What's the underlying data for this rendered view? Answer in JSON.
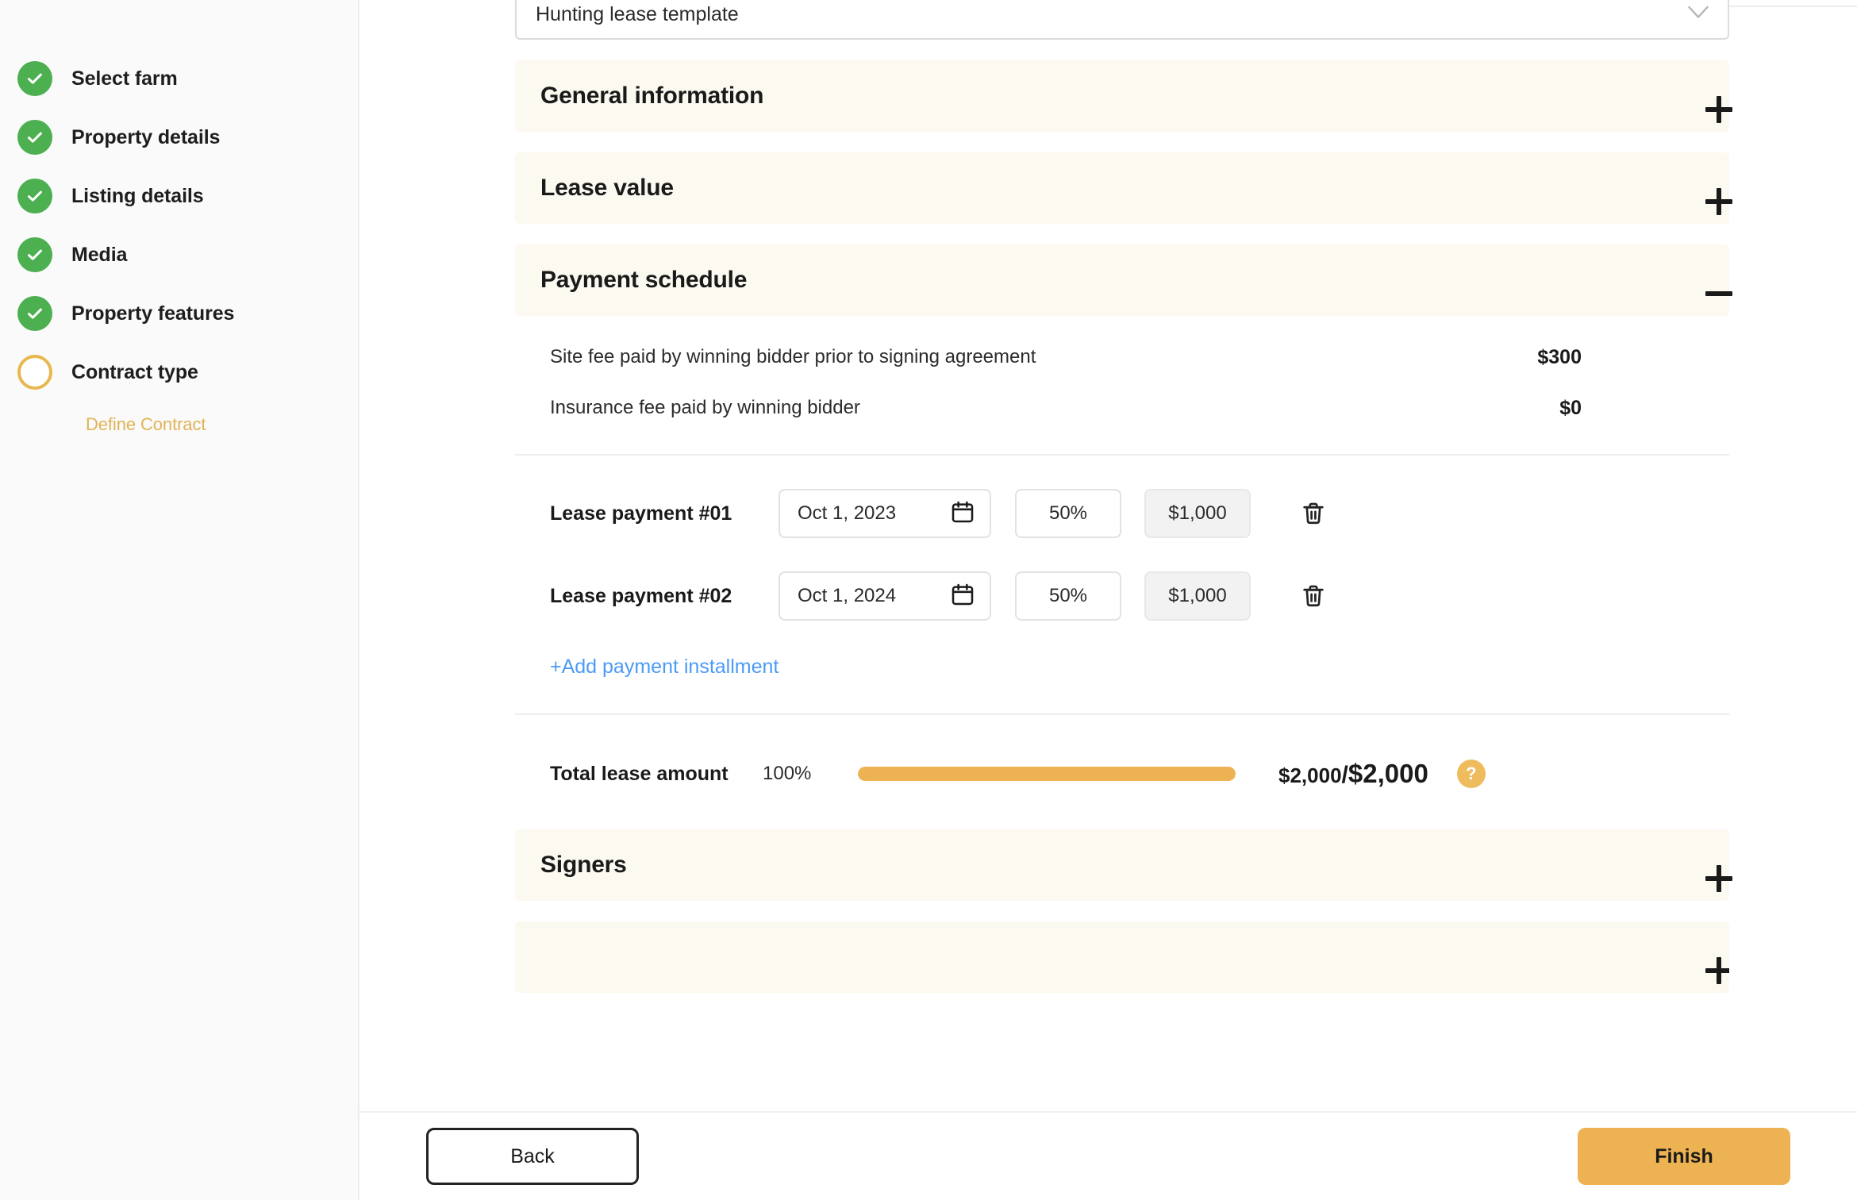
{
  "sidebar": {
    "steps": [
      {
        "label": "Select farm",
        "state": "done",
        "icon": "check-circle-icon"
      },
      {
        "label": "Property details",
        "state": "done",
        "icon": "check-circle-icon"
      },
      {
        "label": "Listing details",
        "state": "done",
        "icon": "check-circle-icon"
      },
      {
        "label": "Media",
        "state": "done",
        "icon": "check-circle-icon"
      },
      {
        "label": "Property features",
        "state": "done",
        "icon": "check-circle-icon"
      },
      {
        "label": "Contract type",
        "state": "current",
        "icon": "empty-circle-icon"
      }
    ],
    "substep": {
      "label": "Define Contract"
    }
  },
  "template_select": {
    "value": "Hunting lease template",
    "chevron": "chevron-down-icon"
  },
  "sections": [
    {
      "title": "General information",
      "expanded": false,
      "toggle": "plus-icon"
    },
    {
      "title": "Lease value",
      "expanded": false,
      "toggle": "plus-icon"
    },
    {
      "title": "Payment schedule",
      "expanded": true,
      "toggle": "minus-icon"
    },
    {
      "title": "Signers",
      "expanded": false,
      "toggle": "plus-icon"
    }
  ],
  "payment_schedule": {
    "fees": [
      {
        "label": "Site fee paid by winning bidder prior to signing agreement",
        "value": "$300"
      },
      {
        "label": "Insurance fee paid by winning bidder",
        "value": "$0"
      }
    ],
    "installments": [
      {
        "label": "Lease payment #01",
        "date": "Oct 1, 2023",
        "date_icon": "calendar-icon",
        "percent": "50%",
        "amount": "$1,000",
        "delete_icon": "trash-icon"
      },
      {
        "label": "Lease payment #02",
        "date": "Oct 1, 2024",
        "date_icon": "calendar-icon",
        "percent": "50%",
        "amount": "$1,000",
        "delete_icon": "trash-icon"
      }
    ],
    "add_link": "+Add payment installment",
    "total": {
      "label": "Total lease amount",
      "percent": "100%",
      "progress": 100,
      "paid": "$2,000",
      "separator": "/",
      "goal": "$2,000",
      "help_icon": "help-circle-icon",
      "help_glyph": "?"
    }
  },
  "footer": {
    "back_label": "Back",
    "finish_label": "Finish"
  },
  "colors": {
    "accent_amber": "#edb352",
    "done_green": "#4caf50",
    "link_blue": "#4b9bf5",
    "section_bg": "#fcf9f0",
    "sidebar_bg": "#fafafa"
  }
}
